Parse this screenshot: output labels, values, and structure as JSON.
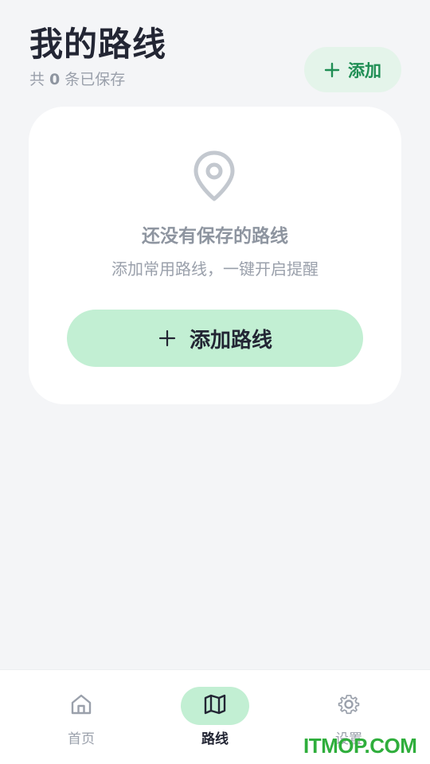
{
  "header": {
    "title": "我的路线",
    "subtitle_prefix": "共",
    "route_count": "0",
    "subtitle_suffix": "条已保存",
    "add_label": "添加",
    "add_icon": "plus-icon"
  },
  "empty_state": {
    "icon": "map-pin-icon",
    "title": "还没有保存的路线",
    "description": "添加常用路线，一键开启提醒",
    "button_label": "添加路线",
    "button_icon": "plus-icon"
  },
  "bottom_nav": {
    "items": [
      {
        "label": "首页",
        "icon": "home-icon",
        "active": false
      },
      {
        "label": "路线",
        "icon": "map-icon",
        "active": true
      },
      {
        "label": "设置",
        "icon": "gear-icon",
        "active": false
      }
    ]
  },
  "watermark": {
    "text": "ITMOP.COM"
  },
  "colors": {
    "background": "#f4f5f7",
    "accent_green": "#1f8e54",
    "accent_green_light": "#c2efd3",
    "pill_bg": "#e4f4ea",
    "text_dark": "#232634",
    "text_muted": "#9aa0ab",
    "watermark_green": "#2fae3c"
  }
}
